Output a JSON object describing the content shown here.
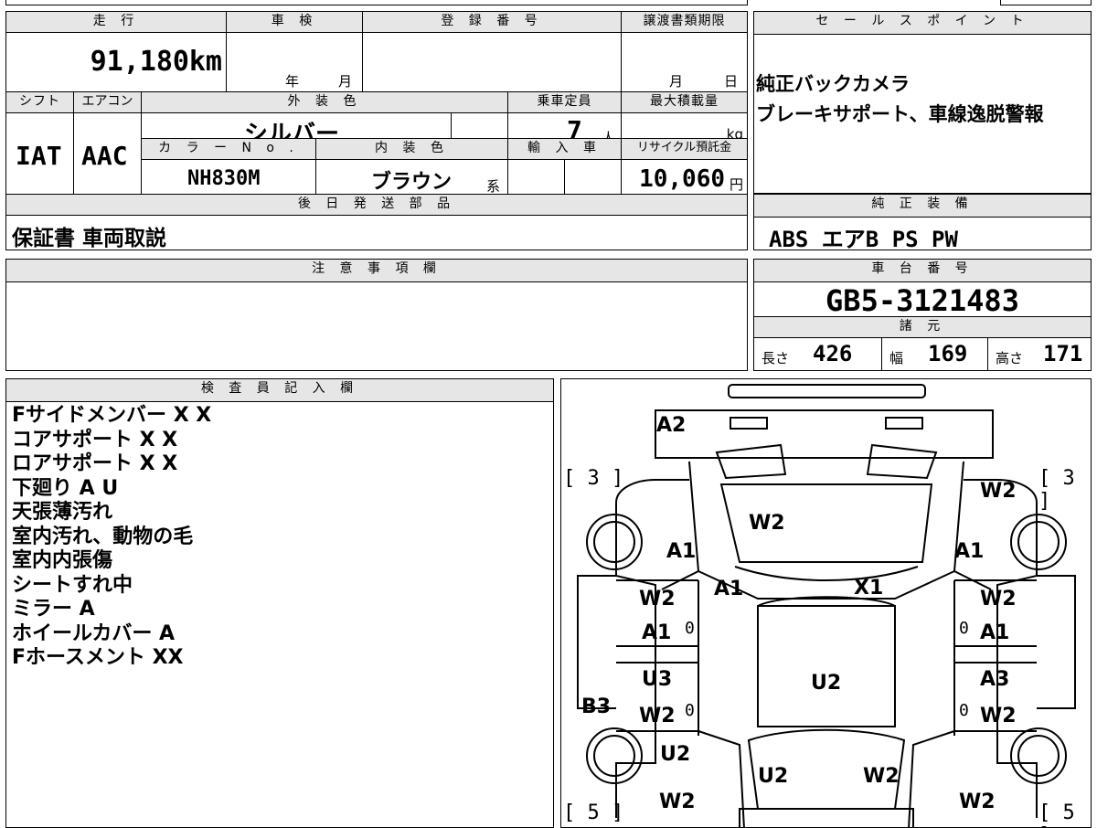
{
  "main": {
    "mileage_label": "走 行",
    "mileage_value": "91,180",
    "mileage_unit": "km",
    "inspection_label": "車 検",
    "year_unit": "年",
    "month_unit": "月",
    "reg_label": "登 録 番 号",
    "transfer_label": "譲渡書類期限",
    "transfer_month": "月",
    "transfer_day": "日",
    "shift_label": "シフト",
    "ac_label": "エアコン",
    "exterior_label": "外 装 色",
    "capacity_label": "乗車定員",
    "load_label": "最大積載量",
    "shift_value": "IAT",
    "ac_value": "AAC",
    "exterior_value": "シルバー",
    "capacity_value": "7",
    "capacity_unit": "人",
    "load_unit": "kg",
    "color_no_label": "カ ラ ー N o .",
    "interior_label": "内 装 色",
    "import_label": "輸 入 車",
    "recycle_label": "リサイクル預託金",
    "color_no_value": "NH830M",
    "interior_value": "ブラウン",
    "interior_suffix": "系",
    "recycle_value": "10,060",
    "recycle_unit": "円",
    "later_parts_label": "後 日 発 送 部 品",
    "later_parts_value": "保証書 車両取説"
  },
  "sales": {
    "label": "セ ー ル ス ポ イ ン ト",
    "lines": [
      "純正バックカメラ",
      "ブレーキサポート、車線逸脱警報"
    ]
  },
  "equipment": {
    "label": "純 正 装 備",
    "value": "ABS エアB PS PW"
  },
  "notes": {
    "label": "注 意 事 項 欄"
  },
  "chassis": {
    "label": "車 台 番 号",
    "value": "GB5-3121483",
    "specs_label": "諸 元",
    "length_label": "長さ",
    "length_value": "426",
    "width_label": "幅",
    "width_value": "169",
    "height_label": "高さ",
    "height_value": "171"
  },
  "inspector": {
    "label": "検 査 員 記 入 欄",
    "lines": [
      "Fサイドメンバー X X",
      "コアサポート X X",
      "ロアサポート X X",
      "下廻り A U",
      "天張薄汚れ",
      "室内汚れ、動物の毛",
      "室内内張傷",
      "シートすれ中",
      "ミラー A",
      "ホイールカバー A",
      "Fホースメント XX"
    ]
  },
  "diagram": {
    "marks": {
      "a2": "A2",
      "w2_hood": "W2",
      "a1_fl": "A1",
      "a1_fr": "A1",
      "a1_cowl": "A1",
      "x1_cowl": "X1",
      "w2_fl": "W2",
      "w2_fr": "W2",
      "w2_fdl": "W2",
      "a1_fdl": "A1",
      "w2_fdr": "W2",
      "a1_fdr": "A1",
      "u3_rdl": "U3",
      "u2_roof": "U2",
      "a3_rdr": "A3",
      "b3": "B3",
      "w2_rdl": "W2",
      "w2_rdr": "W2",
      "u2_rl": "U2",
      "u2_trunk": "U2",
      "w2_trunk": "W2",
      "w2_rrl": "W2",
      "w2_rrr": "W2",
      "zero1": "0",
      "zero2": "0",
      "zero3": "0",
      "zero4": "0"
    },
    "brackets": {
      "tl": "[ 3 ]",
      "tr": "[ 3 ]",
      "bl": "[ 5 ]",
      "br": "[ 5 ]"
    }
  }
}
